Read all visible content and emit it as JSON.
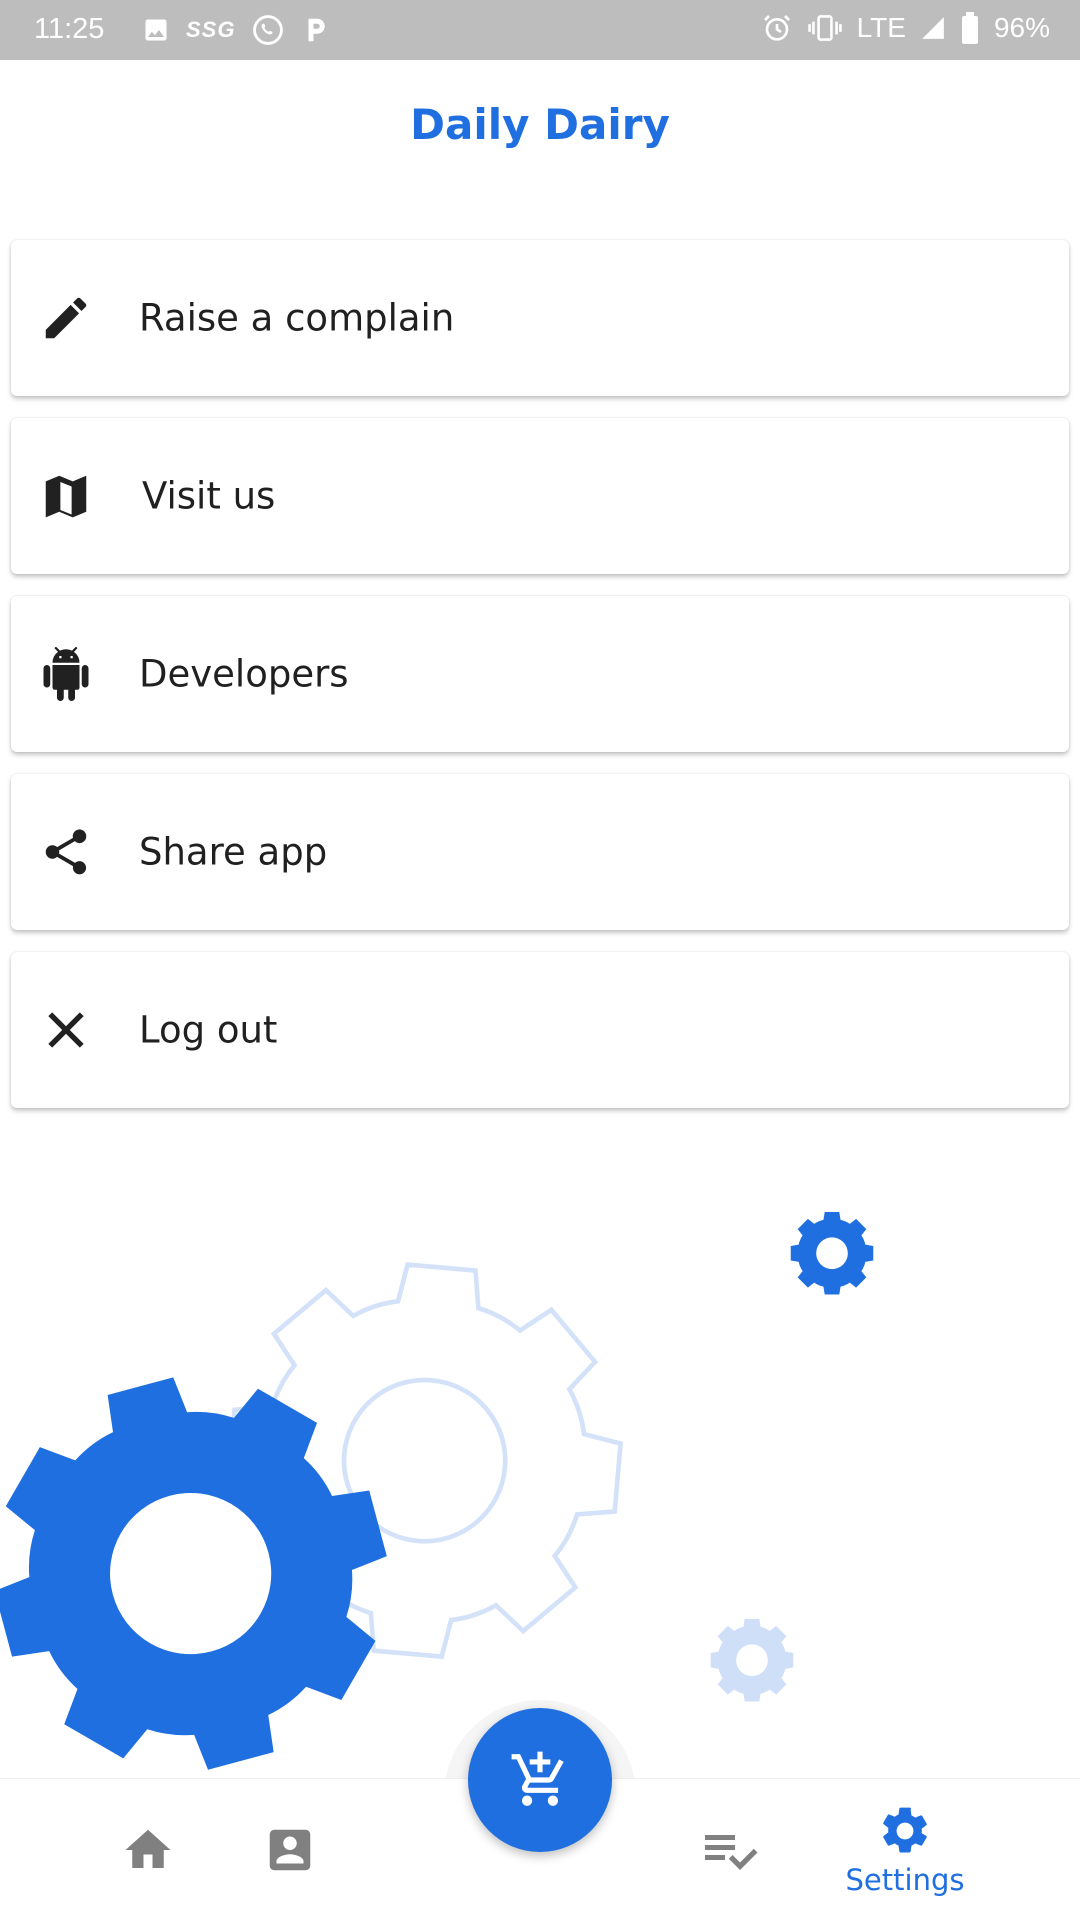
{
  "status_bar": {
    "time": "11:25",
    "carrier_tag": "SSG",
    "network": "LTE",
    "battery": "96%"
  },
  "app": {
    "title": "Daily Dairy"
  },
  "menu": [
    {
      "label": "Raise a complain",
      "icon": "pencil-icon"
    },
    {
      "label": "Visit us",
      "icon": "map-icon"
    },
    {
      "label": "Developers",
      "icon": "android-icon"
    },
    {
      "label": "Share app",
      "icon": "share-icon"
    },
    {
      "label": "Log out",
      "icon": "close-icon"
    }
  ],
  "bottom_nav": {
    "items": [
      {
        "icon": "home-icon",
        "label": ""
      },
      {
        "icon": "account-box-icon",
        "label": ""
      },
      {
        "icon": "playlist-check-icon",
        "label": ""
      },
      {
        "icon": "settings-icon",
        "label": "Settings",
        "active": true
      }
    ],
    "fab_icon": "add-to-cart-icon"
  },
  "colors": {
    "accent": "#1f6fe0",
    "accent_light": "#cfdff7",
    "status_bar": "#bdbdbd",
    "nav_inactive": "#808080"
  }
}
